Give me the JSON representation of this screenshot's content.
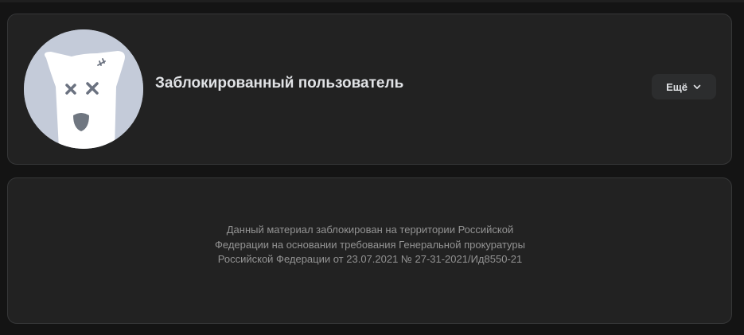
{
  "profile": {
    "name": "Заблокированный пользователь",
    "avatar_icon": "blocked-dog-icon",
    "more_button_label": "Ещё",
    "more_button_icon": "chevron-down-icon"
  },
  "notice": {
    "text": "Данный материал заблокирован на территории Российской Федерации на основании требования Генеральной прокуратуры Российской Федерации от 23.07.2021 № 27-31-2021/Ид8550-21"
  },
  "colors": {
    "page_background": "#141414",
    "card_background": "#222222",
    "card_border": "#363738",
    "avatar_background": "#c4cbd9",
    "primary_text": "#e1e3e6",
    "secondary_text": "#939393",
    "button_background": "#2c2d2e"
  }
}
